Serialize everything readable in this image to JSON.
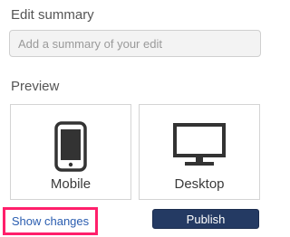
{
  "edit_summary": {
    "label": "Edit summary",
    "placeholder": "Add a summary of your edit",
    "value": ""
  },
  "preview": {
    "label": "Preview",
    "options": [
      {
        "label": "Mobile",
        "icon": "phone-icon"
      },
      {
        "label": "Desktop",
        "icon": "monitor-icon"
      }
    ]
  },
  "actions": {
    "show_changes_label": "Show changes",
    "publish_label": "Publish"
  },
  "colors": {
    "highlight": "#ff1f6b",
    "link": "#2a5db0",
    "publish_bg": "#243a63"
  }
}
